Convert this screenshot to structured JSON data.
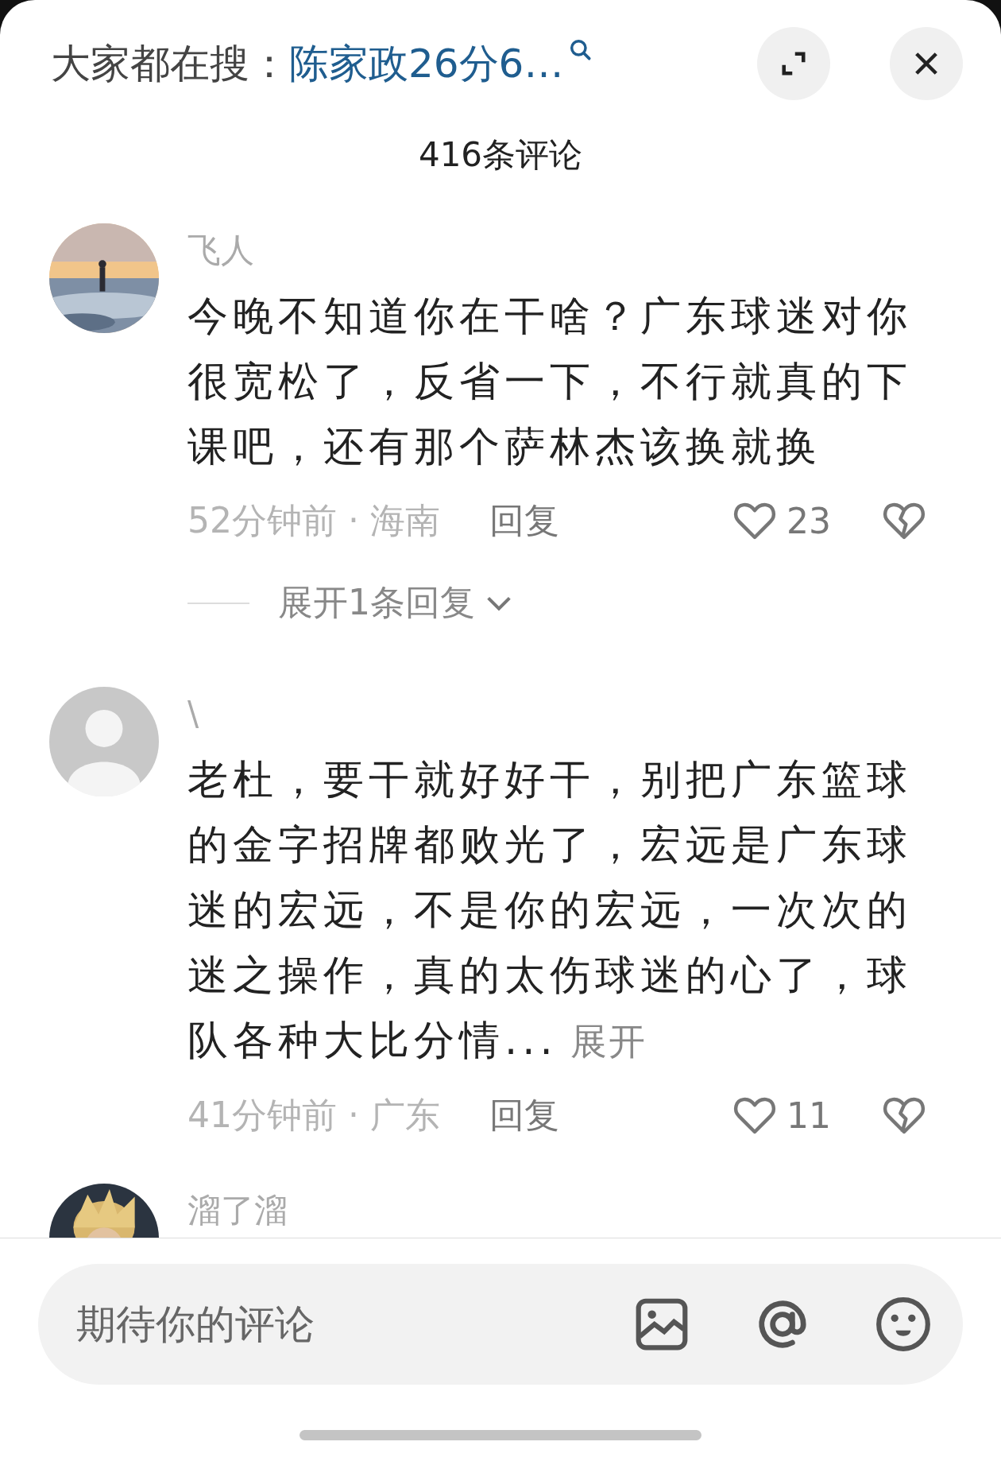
{
  "search_bar": {
    "label": "大家都在搜：",
    "query": "陈家政26分6…"
  },
  "title": "416条评论",
  "comments": [
    {
      "name": "飞人",
      "text": "今晚不知道你在干啥？广东球迷对你很宽松了，反省一下，不行就真的下课吧，还有那个萨林杰该换就换",
      "time": "52分钟前",
      "separator": "·",
      "region": "海南",
      "reply": "回复",
      "likes": "23",
      "expand_replies": "展开1条回复"
    },
    {
      "avatar": {
        "kind": "default"
      },
      "name": "\\",
      "text": "老杜，要干就好好干，别把广东篮球的金字招牌都败光了，宏远是广东球迷的宏远，不是你的宏远，一次次的迷之操作，真的太伤球迷的心了，球队各种大比分情...",
      "more": "展开",
      "time": "41分钟前",
      "separator": "·",
      "region": "广东",
      "reply": "回复",
      "likes": "11"
    },
    {
      "name": "溜了溜"
    }
  ],
  "input": {
    "placeholder": "期待你的评论"
  }
}
